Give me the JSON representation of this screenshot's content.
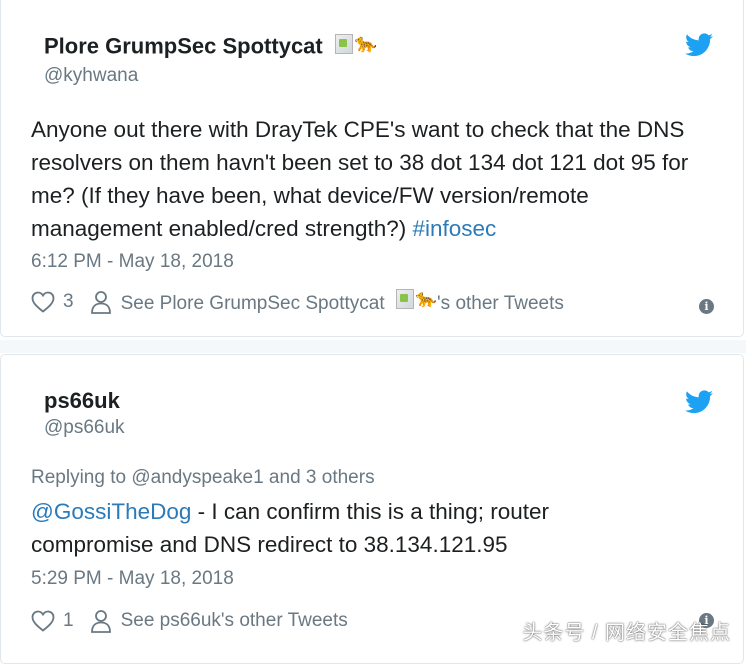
{
  "tweets": [
    {
      "name": "Plore GrumpSec Spottycat",
      "handle": "@kyhwana",
      "text_before": "Anyone out there with DrayTek CPE's want to check that the DNS resolvers on them havn't been set to 38 dot 134 dot 121 dot 95 for me? (If they have been, what device/FW version/remote management enabled/cred strength?) ",
      "hashtag": "#infosec",
      "timestamp": "6:12 PM - May 18, 2018",
      "likes": "3",
      "see_other_prefix": "See Plore GrumpSec Spottycat",
      "see_other_suffix": "'s other Tweets"
    },
    {
      "name": "ps66uk",
      "handle": "@ps66uk",
      "replying_to": "Replying to @andyspeake1 and 3 others",
      "mention": "@GossiTheDog",
      "text_after": " - I can confirm this is a thing; router compromise and DNS redirect to 38.134.121.95",
      "timestamp": "5:29 PM - May 18, 2018",
      "likes": "1",
      "see_other": "See ps66uk's other Tweets"
    }
  ],
  "watermark": "头条号 / 网络安全焦点",
  "colors": {
    "twitter_blue": "#1da1f2",
    "link": "#2b7bb9",
    "muted": "#697882",
    "text": "#1c2022"
  },
  "icons": [
    "twitter-bird-icon",
    "heart-icon",
    "person-icon",
    "info-icon",
    "broken-image-icon",
    "leopard-emoji-icon"
  ]
}
